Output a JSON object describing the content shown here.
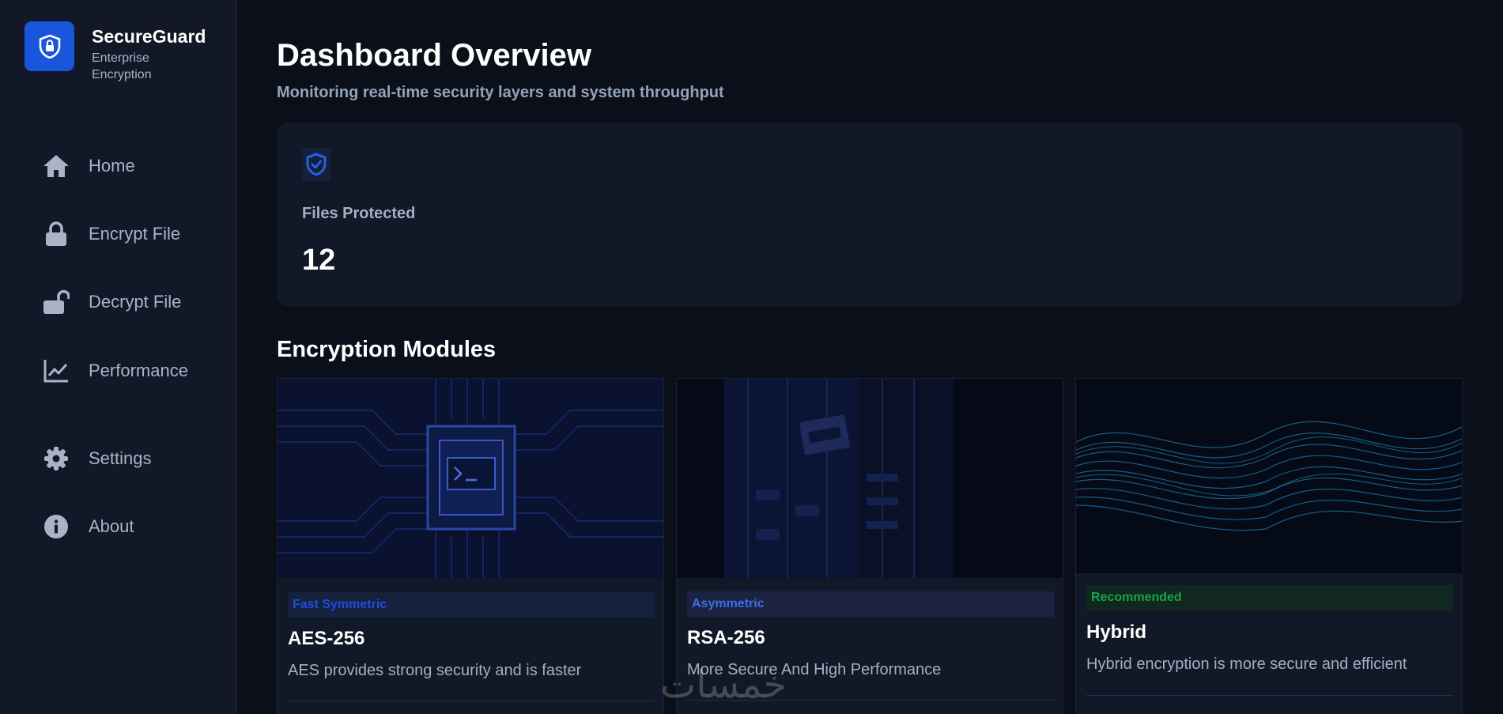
{
  "brand": {
    "name": "SecureGuard",
    "subtitle": "Enterprise Encryption",
    "logo_icon": "shield-lock-icon",
    "accent": "#1a56db"
  },
  "sidebar": {
    "items": [
      {
        "label": "Home",
        "icon": "home-icon"
      },
      {
        "label": "Encrypt File",
        "icon": "lock-icon"
      },
      {
        "label": "Decrypt File",
        "icon": "unlock-icon"
      },
      {
        "label": "Performance",
        "icon": "chart-line-icon"
      },
      {
        "label": "Settings",
        "icon": "gear-icon"
      },
      {
        "label": "About",
        "icon": "info-icon"
      }
    ]
  },
  "header": {
    "title": "Dashboard Overview",
    "subtitle": "Monitoring real-time security layers and system throughput"
  },
  "stats": {
    "icon": "shield-check-icon",
    "label": "Files Protected",
    "value": "12"
  },
  "modules": {
    "section_title": "Encryption Modules",
    "items": [
      {
        "tag": "Fast Symmetric",
        "tag_color": "#1d4ed8",
        "tag_bg": "#16213d",
        "name": "AES-256",
        "description": "AES provides strong security and is faster",
        "image": "circuit-chip-image"
      },
      {
        "tag": "Asymmetric",
        "tag_color": "#3b6ee8",
        "tag_bg": "#1b2340",
        "name": "RSA-256",
        "description": "More Secure And High Performance",
        "image": "server-rack-image"
      },
      {
        "tag": "Recommended",
        "tag_color": "#16a34a",
        "tag_bg": "#10281f",
        "name": "Hybrid",
        "description": "Hybrid encryption is more secure and efficient",
        "image": "data-wave-image"
      }
    ]
  },
  "watermark": "خمسات"
}
